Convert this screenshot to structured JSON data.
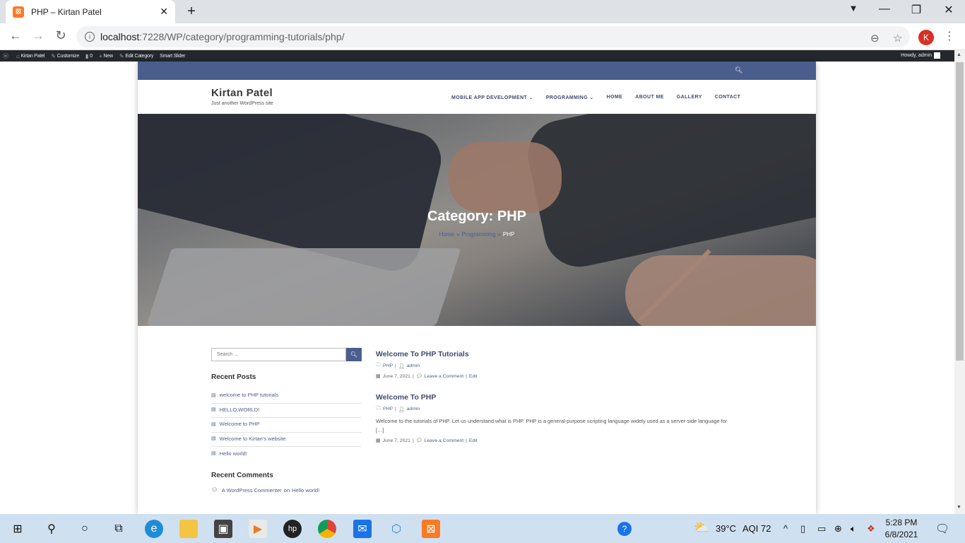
{
  "browser": {
    "tab_title": "PHP – Kirtan Patel",
    "url_host": "localhost",
    "url_rest": ":7228/WP/category/programming-tutorials/php/",
    "avatar_letter": "K"
  },
  "adminbar": {
    "items": [
      "Kirtan Patel",
      "Customize",
      "0",
      "New",
      "Edit Category",
      "Smart Slider"
    ],
    "howdy": "Howdy, admin"
  },
  "site": {
    "title": "Kirtan Patel",
    "tagline": "Just another WordPress site",
    "nav": [
      "MOBILE APP DEVELOPMENT ⌄",
      "PROGRAMMING ⌄",
      "HOME",
      "ABOUT ME",
      "GALLERY",
      "CONTACT"
    ]
  },
  "hero": {
    "title": "Category: PHP",
    "breadcrumb": [
      "Home",
      "Programming",
      "PHP"
    ]
  },
  "sidebar": {
    "search_placeholder": "Search ...",
    "recent_posts_title": "Recent Posts",
    "recent_posts": [
      "welcome to PHP tutorials",
      "HELLO,WORLD!",
      "Welcome to PHP",
      "Welcome to Kirtan's website.",
      "Hello world!"
    ],
    "recent_comments_title": "Recent Comments",
    "comment_author": "A WordPress Commenter",
    "comment_on": "on",
    "comment_post": "Hello world!"
  },
  "posts": [
    {
      "title": "Welcome To PHP Tutorials",
      "category": "PHP",
      "author": "admin",
      "date": "June 7, 2021",
      "comment": "Leave a Comment",
      "edit": "Edit",
      "excerpt": ""
    },
    {
      "title": "Welcome To PHP",
      "category": "PHP",
      "author": "admin",
      "date": "June 7, 2021",
      "comment": "Leave a Comment",
      "edit": "Edit",
      "excerpt": "Welcome to the tutorials of PHP. Let us understand what is PHP. PHP is a general-purpose scripting language widely used as a server-side language for […]"
    }
  ],
  "taskbar": {
    "temperature": "39°C",
    "aqi": "AQI 72",
    "time": "5:28 PM",
    "date": "6/8/2021"
  },
  "colors": {
    "accent": "#4a5e8e",
    "adminbar": "#23282d",
    "taskbar": "#cfe0f0"
  }
}
